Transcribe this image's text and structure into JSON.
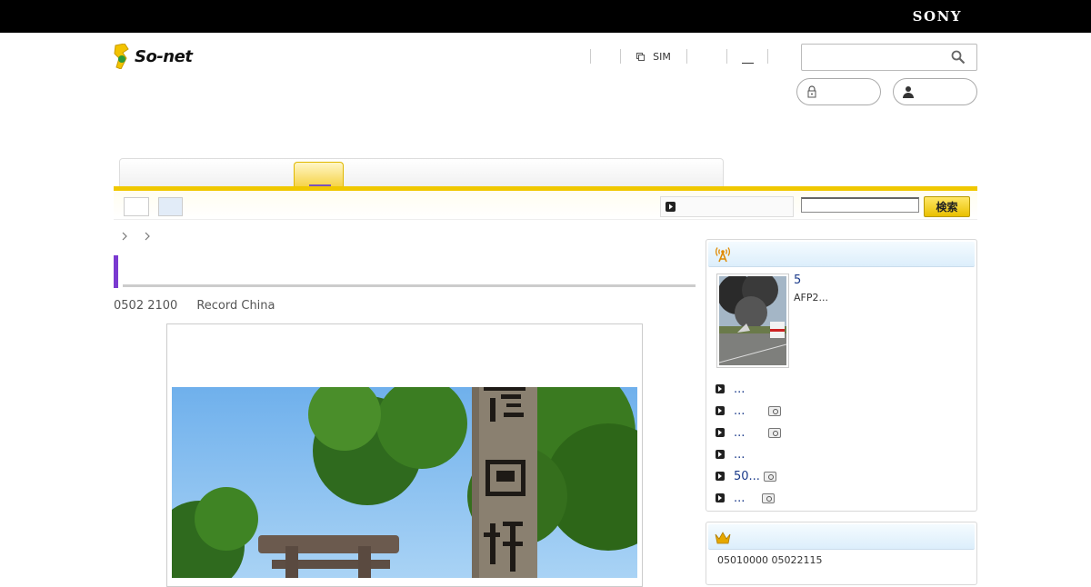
{
  "brand": {
    "sony": "SONY",
    "logo": "So-net"
  },
  "header": {
    "links": [
      "",
      "SIM",
      "",
      "",
      ""
    ],
    "search_placeholder": ""
  },
  "subnav": {
    "search_button": "検索"
  },
  "article": {
    "meta_date": "0502 2100",
    "meta_source": "Record China"
  },
  "sidebar": {
    "news": {
      "headline": "5",
      "subtext": "AFP2...",
      "items": [
        {
          "text": "...",
          "has_photo": false
        },
        {
          "text": "...",
          "has_photo": true
        },
        {
          "text": "...",
          "has_photo": true
        },
        {
          "text": "...",
          "has_photo": false
        },
        {
          "text": "50...",
          "has_photo": true
        },
        {
          "text": "...",
          "has_photo": true
        }
      ]
    },
    "ranking": {
      "period": "05010000  05022115"
    }
  },
  "colors": {
    "accent_yellow": "#f0c800",
    "accent_purple": "#7a3ad0",
    "link_blue": "#1a3a8a"
  }
}
